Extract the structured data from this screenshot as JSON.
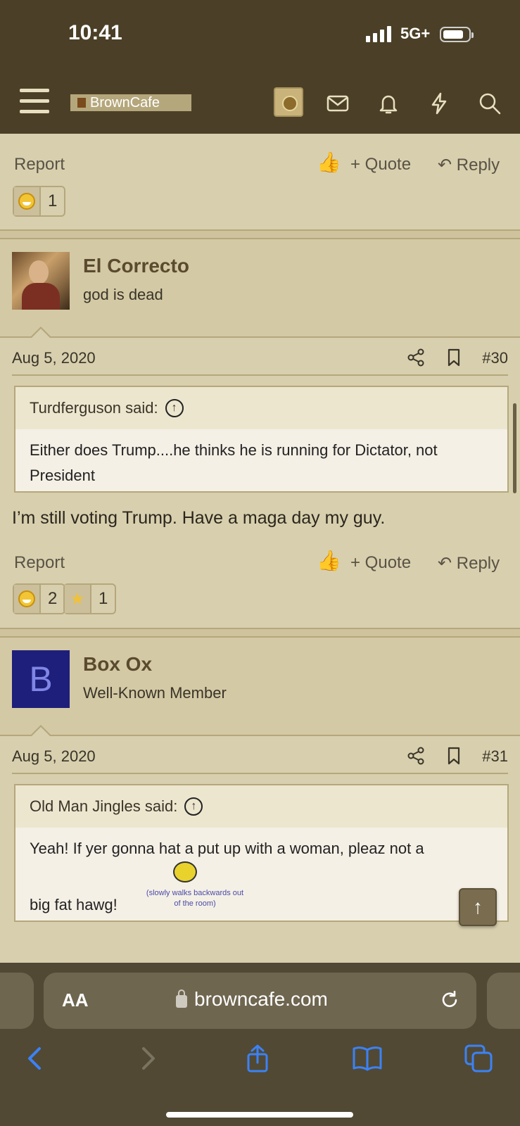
{
  "status": {
    "time": "10:41",
    "network": "5G+"
  },
  "header": {
    "logo_text": "BrownCafe",
    "icons": [
      "menu-icon",
      "mail-icon",
      "bell-icon",
      "bolt-icon",
      "search-icon"
    ]
  },
  "top_post": {
    "actions": {
      "report": "Report",
      "quote": "+ Quote",
      "reply": "Reply"
    },
    "reactions": [
      {
        "icon": "laugh-icon",
        "count": "1"
      }
    ]
  },
  "post30": {
    "username": "El Correcto",
    "user_title": "god is dead",
    "date": "Aug 5, 2020",
    "number": "#30",
    "quote_author": "Turdferguson said:",
    "quote_text": "Either does Trump....he thinks he is running for Dictator, not President",
    "text": "I’m still voting Trump. Have a maga day my guy.",
    "actions": {
      "report": "Report",
      "quote": "+ Quote",
      "reply": "Reply"
    },
    "reactions": [
      {
        "icon": "laugh-icon",
        "count": "2"
      },
      {
        "icon": "star-icon",
        "count": "1"
      }
    ]
  },
  "post31": {
    "avatar_letter": "B",
    "username": "Box Ox",
    "user_title": "Well-Known Member",
    "date": "Aug 5, 2020",
    "number": "#31",
    "quote_author": "Old Man Jingles said:",
    "quote_line1": "Yeah! If yer gonna hat a put up with a woman, pleaz not a",
    "quote_line2": "big fat hawg!",
    "sticker_caption": "(slowly walks backwards out of the room)"
  },
  "browser": {
    "aa_label": "AA",
    "url": "browncafe.com"
  },
  "colors": {
    "header_bg": "#4b4027",
    "page_bg": "#d8cfae",
    "accent": "#b5a77c"
  }
}
